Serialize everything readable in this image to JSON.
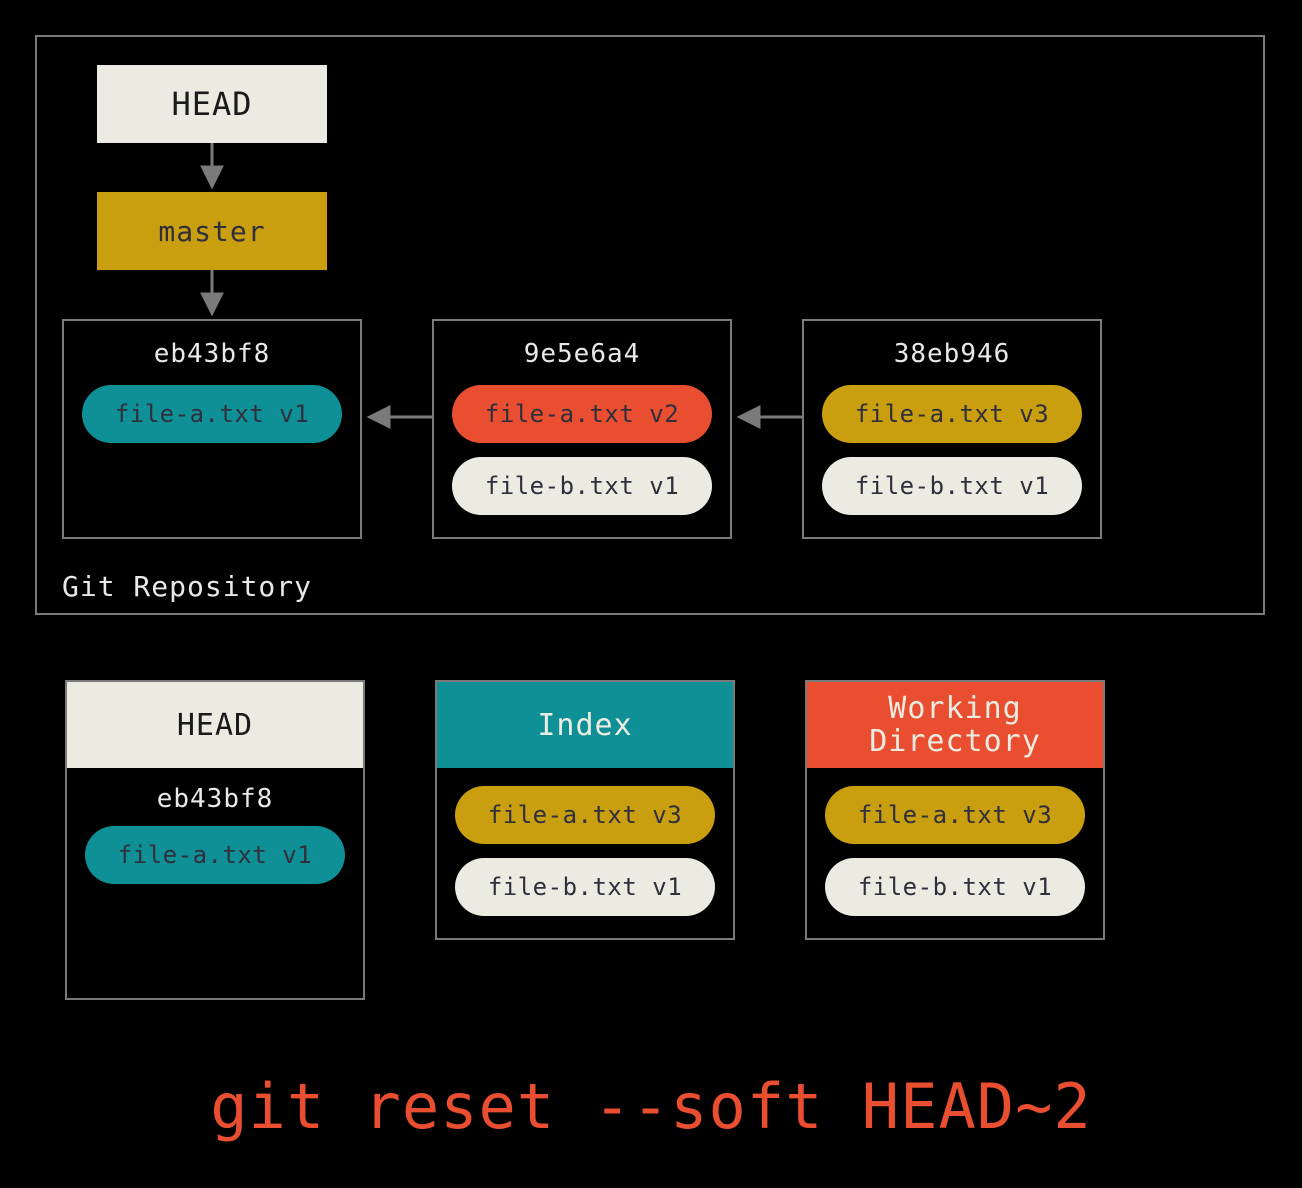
{
  "repo_label": "Git Repository",
  "head_label": "HEAD",
  "branch_label": "master",
  "commits": [
    {
      "hash": "eb43bf8",
      "files": [
        {
          "label": "file-a.txt v1",
          "style": "teal"
        }
      ]
    },
    {
      "hash": "9e5e6a4",
      "files": [
        {
          "label": "file-a.txt v2",
          "style": "orange"
        },
        {
          "label": "file-b.txt v1",
          "style": "cream"
        }
      ]
    },
    {
      "hash": "38eb946",
      "files": [
        {
          "label": "file-a.txt v3",
          "style": "gold"
        },
        {
          "label": "file-b.txt v1",
          "style": "cream"
        }
      ]
    }
  ],
  "panels": [
    {
      "title": "HEAD",
      "header_style": "cream",
      "hash": "eb43bf8",
      "files": [
        {
          "label": "file-a.txt v1",
          "style": "teal"
        }
      ]
    },
    {
      "title": "Index",
      "header_style": "teal",
      "hash": "",
      "files": [
        {
          "label": "file-a.txt v3",
          "style": "gold"
        },
        {
          "label": "file-b.txt v1",
          "style": "cream"
        }
      ]
    },
    {
      "title": "Working\nDirectory",
      "header_style": "orange",
      "hash": "",
      "files": [
        {
          "label": "file-a.txt v3",
          "style": "gold"
        },
        {
          "label": "file-b.txt v1",
          "style": "cream"
        }
      ]
    }
  ],
  "command": "git reset --soft HEAD~2"
}
